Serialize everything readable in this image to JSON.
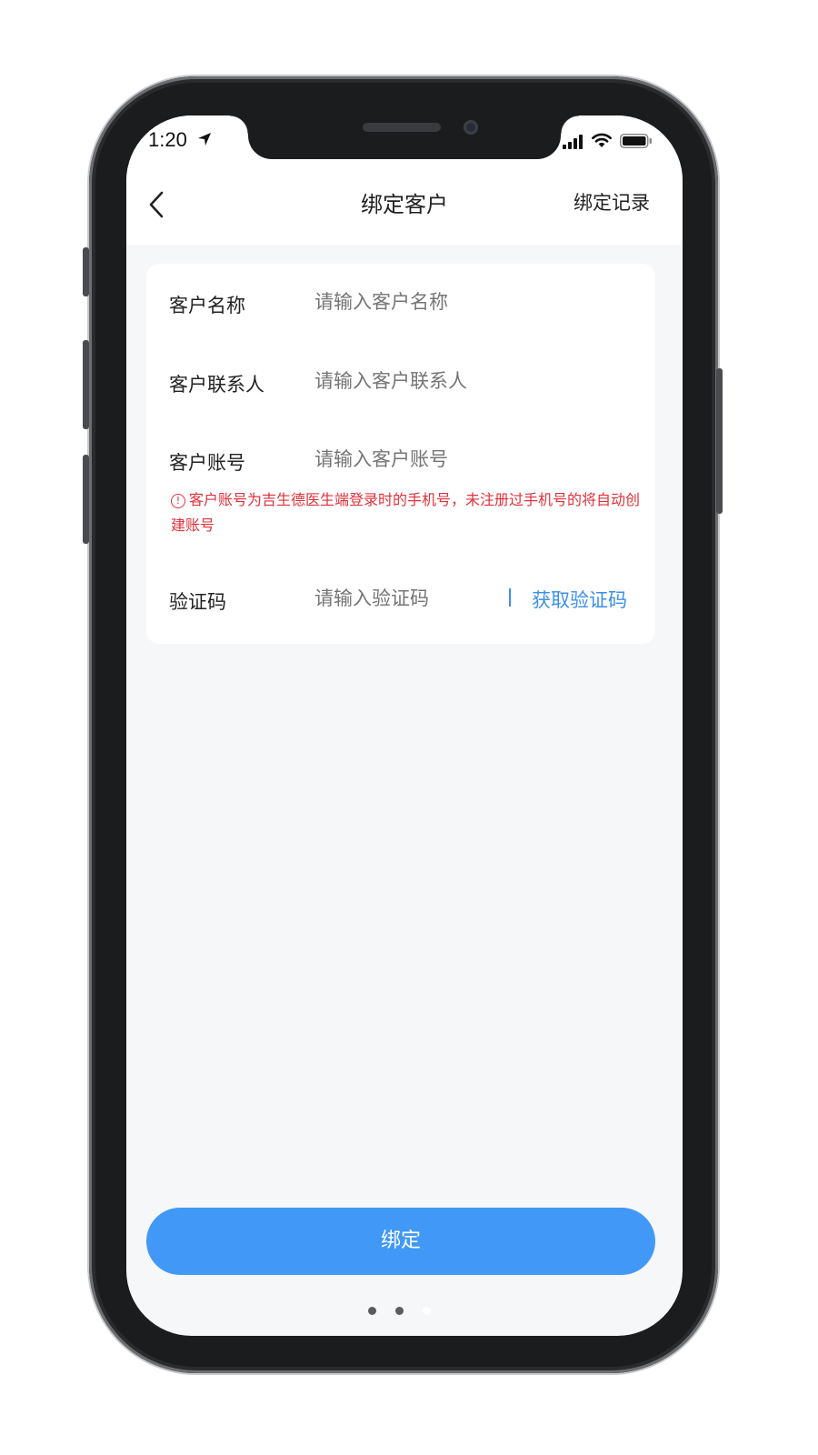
{
  "status_bar": {
    "time": "1:20"
  },
  "nav": {
    "title": "绑定客户",
    "right_link": "绑定记录"
  },
  "form": {
    "name": {
      "label": "客户名称",
      "placeholder": "请输入客户名称"
    },
    "contact": {
      "label": "客户联系人",
      "placeholder": "请输入客户联系人"
    },
    "account": {
      "label": "客户账号",
      "placeholder": "请输入客户账号",
      "hint": "客户账号为吉生德医生端登录时的手机号，未注册过手机号的将自动创建账号"
    },
    "code": {
      "label": "验证码",
      "placeholder": "请输入验证码",
      "get_code": "获取验证码"
    }
  },
  "submit_label": "绑定",
  "page_indicator": {
    "total": 3,
    "active": 3
  },
  "colors": {
    "accent": "#4298f6",
    "link": "#3d8fe8",
    "error": "#e0313a",
    "background": "#f6f7f9"
  }
}
